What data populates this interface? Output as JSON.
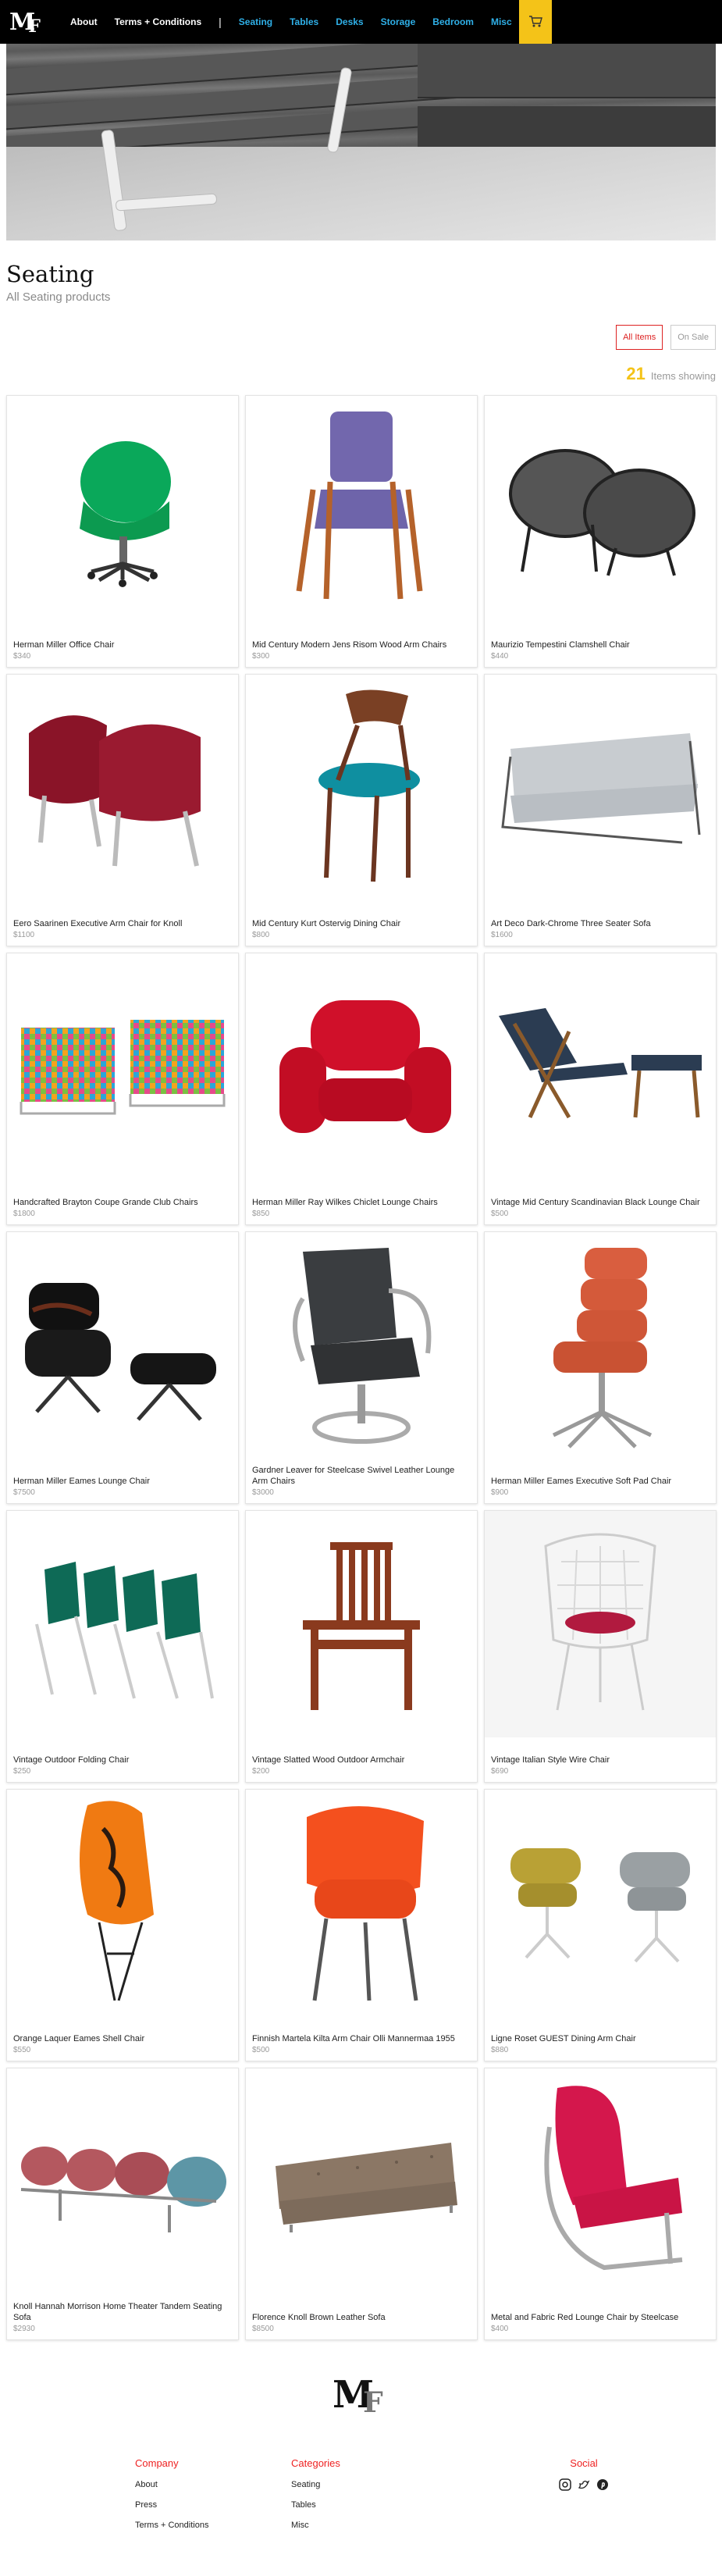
{
  "nav": {
    "logo_m": "M",
    "logo_f": "F",
    "about": "About",
    "terms": "Terms + Conditions",
    "sep1": "|",
    "seating": "Seating",
    "tables": "Tables",
    "desks": "Desks",
    "storage": "Storage",
    "bedroom": "Bedroom",
    "misc": "Misc",
    "sep2": "|",
    "cart_icon": "cart-icon"
  },
  "page": {
    "title": "Seating",
    "subtitle": "All Seating products",
    "filter_all": "All Items",
    "filter_sale": "On Sale",
    "count": "21",
    "count_label": "Items showing"
  },
  "products": [
    {
      "name": "Herman Miller Office Chair",
      "price": "$340"
    },
    {
      "name": "Mid Century Modern Jens Risom Wood Arm Chairs",
      "price": "$300"
    },
    {
      "name": "Maurizio Tempestini Clamshell Chair",
      "price": "$440"
    },
    {
      "name": "Eero Saarinen Executive Arm Chair for Knoll",
      "price": "$1100"
    },
    {
      "name": "Mid Century Kurt Ostervig Dining Chair",
      "price": "$800"
    },
    {
      "name": "Art Deco Dark-Chrome Three Seater Sofa",
      "price": "$1600"
    },
    {
      "name": "Handcrafted Brayton Coupe Grande Club Chairs",
      "price": "$1800"
    },
    {
      "name": "Herman Miller Ray Wilkes Chiclet Lounge Chairs",
      "price": "$850"
    },
    {
      "name": "Vintage Mid Century Scandinavian Black Lounge Chair",
      "price": "$500"
    },
    {
      "name": "Herman Miller Eames Lounge Chair",
      "price": "$7500"
    },
    {
      "name": "Gardner Leaver for Steelcase Swivel Leather Lounge Arm Chairs",
      "price": "$3000"
    },
    {
      "name": "Herman Miller Eames Executive Soft Pad Chair",
      "price": "$900"
    },
    {
      "name": "Vintage Outdoor Folding Chair",
      "price": "$250"
    },
    {
      "name": "Vintage Slatted Wood Outdoor Armchair",
      "price": "$200"
    },
    {
      "name": "Vintage Italian Style Wire Chair",
      "price": "$690"
    },
    {
      "name": "Orange Laquer Eames Shell Chair",
      "price": "$550"
    },
    {
      "name": "Finnish Martela Kilta Arm Chair Olli Mannermaa 1955",
      "price": "$500"
    },
    {
      "name": "Ligne Roset GUEST Dining Arm Chair",
      "price": "$880"
    },
    {
      "name": "Knoll Hannah Morrison Home Theater Tandem Seating Sofa",
      "price": "$2930"
    },
    {
      "name": "Florence Knoll Brown Leather Sofa",
      "price": "$8500"
    },
    {
      "name": "Metal and Fabric Red Lounge Chair by Steelcase",
      "price": "$400"
    }
  ],
  "footer": {
    "logo_m": "M",
    "logo_f": "F",
    "company_title": "Company",
    "company_links": [
      "About",
      "Press",
      "Terms + Conditions"
    ],
    "categories_title": "Categories",
    "categories_links": [
      "Seating",
      "Tables",
      "Misc"
    ],
    "social_title": "Social",
    "social_icons": [
      "instagram-icon",
      "twitter-icon",
      "pinterest-icon"
    ]
  },
  "colors": {
    "accent_yellow": "#f4c318",
    "nav_link_blue": "#2fb0e8",
    "footer_red": "#ee2222",
    "filter_red": "#dd2222"
  }
}
